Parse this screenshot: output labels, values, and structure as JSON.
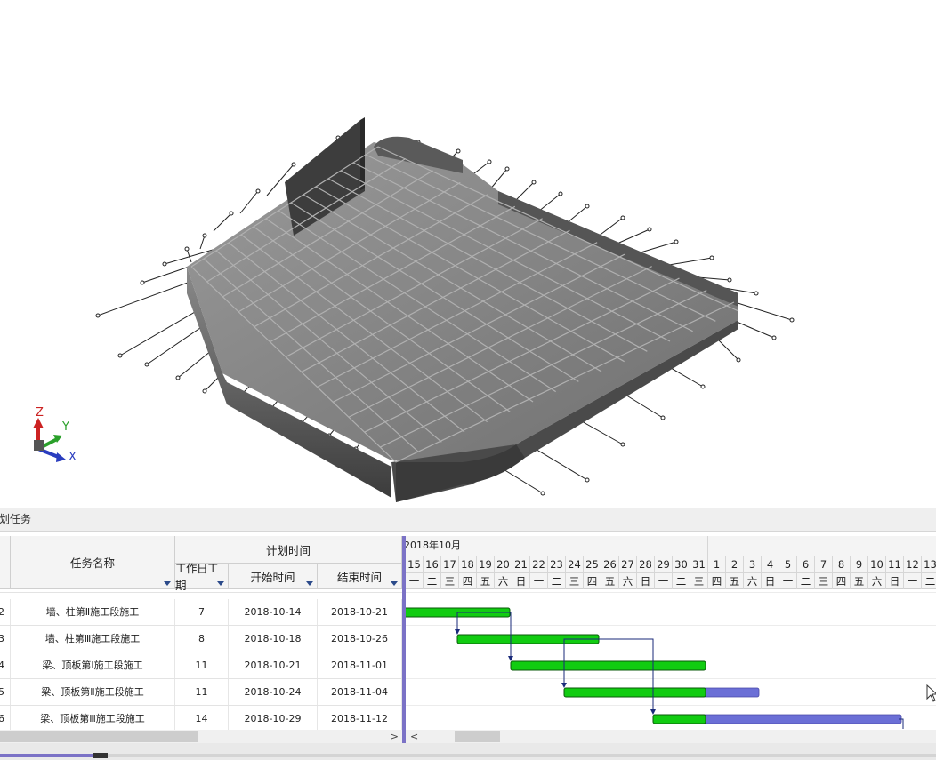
{
  "viewport": {
    "axes": {
      "z": "Z",
      "y": "Y",
      "x": "X"
    },
    "colors": {
      "axis_x": "#2a3dbf",
      "axis_y": "#2aa02a",
      "axis_z": "#cc2222",
      "model": "#6e6e6e"
    }
  },
  "panel": {
    "title": "划任务"
  },
  "grid": {
    "header": {
      "task_name": "任务名称",
      "plan_time": "计划时间",
      "duration": "工作日工期",
      "start": "开始时间",
      "end": "结束时间"
    },
    "rows": [
      {
        "id": "2",
        "name": "墙、柱第Ⅱ施工段施工",
        "duration": "7",
        "start": "2018-10-14",
        "end": "2018-10-21"
      },
      {
        "id": "3",
        "name": "墙、柱第Ⅲ施工段施工",
        "duration": "8",
        "start": "2018-10-18",
        "end": "2018-10-26"
      },
      {
        "id": "4",
        "name": "梁、顶板第Ⅰ施工段施工",
        "duration": "11",
        "start": "2018-10-21",
        "end": "2018-11-01"
      },
      {
        "id": "5",
        "name": "梁、顶板第Ⅱ施工段施工",
        "duration": "11",
        "start": "2018-10-24",
        "end": "2018-11-04"
      },
      {
        "id": "6",
        "name": "梁、顶板第Ⅲ施工段施工",
        "duration": "14",
        "start": "2018-10-29",
        "end": "2018-11-12"
      }
    ],
    "scroll_right": ">"
  },
  "chart": {
    "month": "2018年10月",
    "days": [
      "15",
      "16",
      "17",
      "18",
      "19",
      "20",
      "21",
      "22",
      "23",
      "24",
      "25",
      "26",
      "27",
      "28",
      "29",
      "30",
      "31",
      "1",
      "2",
      "3",
      "4",
      "5",
      "6",
      "7",
      "8",
      "9",
      "10",
      "11",
      "12",
      "13"
    ],
    "weekdays": [
      "一",
      "二",
      "三",
      "四",
      "五",
      "六",
      "日",
      "一",
      "二",
      "三",
      "四",
      "五",
      "六",
      "日",
      "一",
      "二",
      "三",
      "四",
      "五",
      "六",
      "日",
      "一",
      "二",
      "三",
      "四",
      "五",
      "六",
      "日",
      "一",
      "二"
    ],
    "scroll_left": "<",
    "colors": {
      "bar": "#11cc11",
      "bar_extra": "#6b6fd6",
      "link": "#1a2a7a"
    },
    "bars": [
      {
        "green": [
          -0.1,
          5.85
        ],
        "blue": null
      },
      {
        "green": [
          2.9,
          10.85
        ],
        "blue": null
      },
      {
        "green": [
          5.9,
          16.85
        ],
        "blue": null
      },
      {
        "green": [
          8.9,
          16.85
        ],
        "blue": [
          16.85,
          19.85
        ]
      },
      {
        "green": [
          13.9,
          16.85
        ],
        "blue": [
          16.85,
          27.85
        ]
      }
    ],
    "links": [
      {
        "from": 0,
        "to": 1,
        "day": 2.9
      },
      {
        "from": 0,
        "to": 2,
        "day": 5.9
      },
      {
        "from": 1,
        "to": 3,
        "day": 8.9
      },
      {
        "from": 1,
        "to": 4,
        "day": 13.9
      }
    ]
  },
  "timeline": {
    "progress": 0.1
  }
}
